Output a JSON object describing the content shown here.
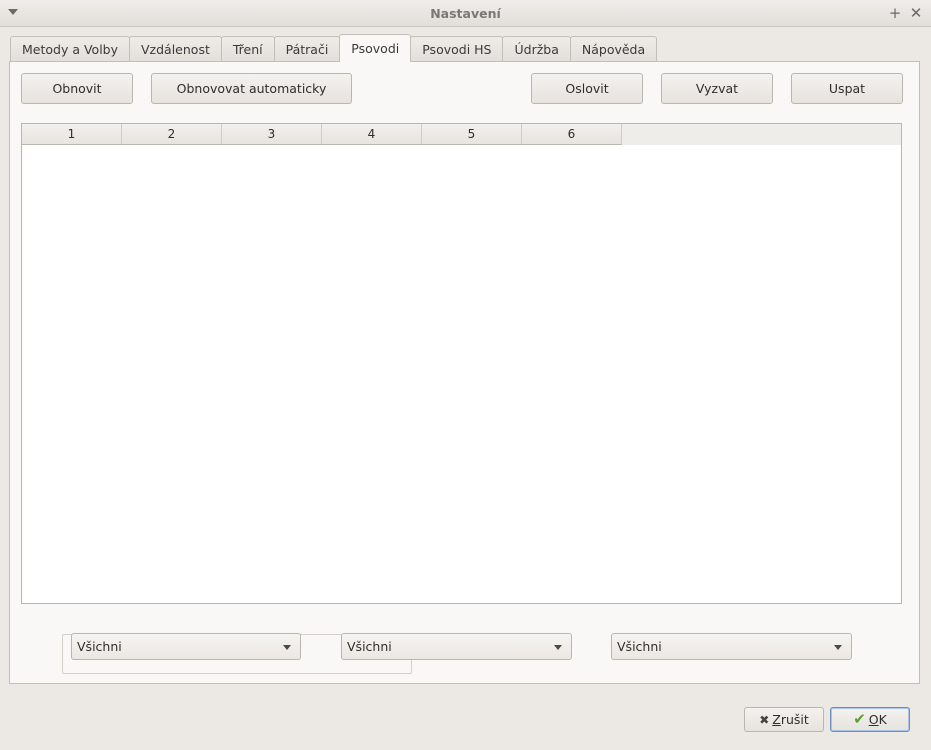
{
  "window": {
    "title": "Nastavení"
  },
  "tabs": [
    {
      "label": "Metody a Volby"
    },
    {
      "label": "Vzdálenost"
    },
    {
      "label": "Tření"
    },
    {
      "label": "Pátrači"
    },
    {
      "label": "Psovodi",
      "active": true
    },
    {
      "label": "Psovodi HS"
    },
    {
      "label": "Údržba"
    },
    {
      "label": "Nápověda"
    }
  ],
  "toolbar": {
    "refresh_label": "Obnovit",
    "auto_refresh_label": "Obnovovat automaticky",
    "address_label": "Oslovit",
    "challenge_label": "Vyzvat",
    "sleep_label": "Uspat"
  },
  "table": {
    "columns": [
      "1",
      "2",
      "3",
      "4",
      "5",
      "6"
    ],
    "rows": []
  },
  "filters": [
    {
      "selected": "Všichni"
    },
    {
      "selected": "Všichni"
    },
    {
      "selected": "Všichni"
    }
  ],
  "dialog": {
    "cancel_label_first": "Z",
    "cancel_label_rest": "rušit",
    "ok_label_first": "O",
    "ok_label_rest": "K"
  }
}
